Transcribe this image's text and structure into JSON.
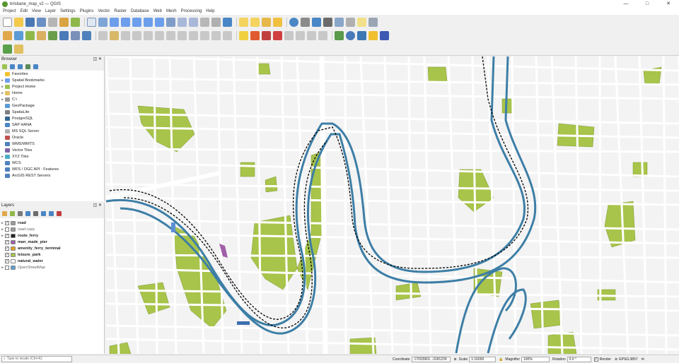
{
  "window": {
    "title": "brisbane_map_v2 — QGIS",
    "controls": [
      "—",
      "□",
      "✕"
    ]
  },
  "menu": [
    "Project",
    "Edit",
    "View",
    "Layer",
    "Settings",
    "Plugins",
    "Vector",
    "Raster",
    "Database",
    "Web",
    "Mesh",
    "Processing",
    "Help"
  ],
  "browser": {
    "title": "Browser",
    "items": [
      {
        "label": "Favorites",
        "icon": "star-icon",
        "color": "#f1c232",
        "expand": ""
      },
      {
        "label": "Spatial Bookmarks",
        "icon": "bookmark-icon",
        "color": "#6d9eeb",
        "expand": "▸"
      },
      {
        "label": "Project Home",
        "icon": "folder-icon",
        "color": "#9cc251",
        "expand": "▸"
      },
      {
        "label": "Home",
        "icon": "folder-icon",
        "color": "#e6c061",
        "expand": "▸"
      },
      {
        "label": "C:\\",
        "icon": "drive-icon",
        "color": "#999999",
        "expand": "▸"
      },
      {
        "label": "GeoPackage",
        "icon": "geopackage-icon",
        "color": "#5b9bd5",
        "expand": ""
      },
      {
        "label": "SpatiaLite",
        "icon": "spatialite-icon",
        "color": "#7f7f7f",
        "expand": ""
      },
      {
        "label": "PostgreSQL",
        "icon": "postgresql-icon",
        "color": "#336791",
        "expand": ""
      },
      {
        "label": "SAP HANA",
        "icon": "saphana-icon",
        "color": "#4a86c5",
        "expand": ""
      },
      {
        "label": "MS SQL Server",
        "icon": "mssql-icon",
        "color": "#b0b0b0",
        "expand": ""
      },
      {
        "label": "Oracle",
        "icon": "oracle-icon",
        "color": "#c0504d",
        "expand": ""
      },
      {
        "label": "WMS/WMTS",
        "icon": "wms-icon",
        "color": "#4f81bd",
        "expand": ""
      },
      {
        "label": "Vector Tiles",
        "icon": "vectortiles-icon",
        "color": "#8064a2",
        "expand": ""
      },
      {
        "label": "XYZ Tiles",
        "icon": "xyz-icon",
        "color": "#4bacc6",
        "expand": "▸"
      },
      {
        "label": "WCS",
        "icon": "wcs-icon",
        "color": "#4f81bd",
        "expand": ""
      },
      {
        "label": "WFS / OGC API - Features",
        "icon": "wfs-icon",
        "color": "#4f81bd",
        "expand": ""
      },
      {
        "label": "ArcGIS REST Servers",
        "icon": "arcgis-icon",
        "color": "#4f81bd",
        "expand": ""
      }
    ]
  },
  "layers": {
    "title": "Layers",
    "items": [
      {
        "label": "road",
        "checked": true,
        "bold": true,
        "italic": false,
        "color": "#9a9a9a",
        "expand": "▸"
      },
      {
        "label": "road copy",
        "checked": false,
        "bold": false,
        "italic": true,
        "color": "#9a9a9a",
        "expand": "▸"
      },
      {
        "label": "route_ferry",
        "checked": true,
        "bold": true,
        "italic": false,
        "color": "#222222",
        "expand": "▸"
      },
      {
        "label": "man_made_pier",
        "checked": true,
        "bold": true,
        "italic": false,
        "color": "#a05fa8",
        "expand": ""
      },
      {
        "label": "amenity_ferry_terminal",
        "checked": true,
        "bold": true,
        "italic": false,
        "color": "#e0a020",
        "expand": ""
      },
      {
        "label": "leisure_park",
        "checked": true,
        "bold": true,
        "italic": false,
        "color": "#a8c44a",
        "expand": ""
      },
      {
        "label": "natural_water",
        "checked": true,
        "bold": true,
        "italic": false,
        "color": "#ffffff",
        "expand": ""
      },
      {
        "label": "OpenStreetMap",
        "checked": false,
        "bold": false,
        "italic": true,
        "color": "#5b9bd5",
        "expand": "▸"
      }
    ]
  },
  "status": {
    "locator_placeholder": "Type to locate (Ctrl+K)",
    "coordinate_label": "Coordinate",
    "coordinate_value": "17033963, -3181239",
    "scale_label": "Scale",
    "scale_value": "1:16000",
    "magnifier_label": "Magnifier",
    "magnifier_value": "100%",
    "rotation_label": "Rotation",
    "rotation_value": "0.0 °",
    "render_label": "Render",
    "crs_value": "EPSG:3857"
  },
  "colors": {
    "park": "#a8c44a",
    "water_edge": "#3d7ea6",
    "road": "#ffffff",
    "ferry": "#000000"
  }
}
